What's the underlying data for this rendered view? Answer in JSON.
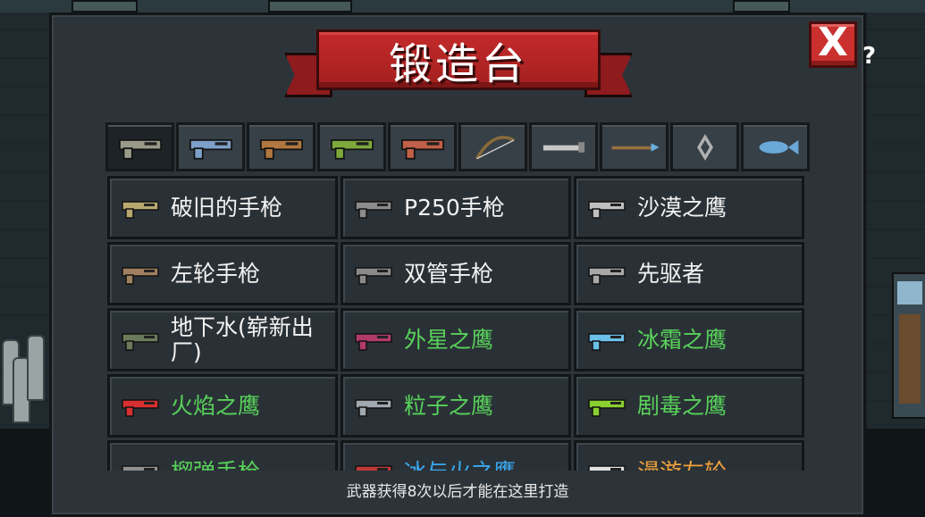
{
  "title": "锻造台",
  "close_icon_label": "X",
  "cut_glyph": "?",
  "colors": {
    "white": "#f2f2f2",
    "green": "#58d25a",
    "blue": "#39a8f0",
    "orange": "#f0a03c",
    "banner": "#b82526"
  },
  "tabs": [
    {
      "icon": "pistol-icon",
      "color": "#9a9a88",
      "active": true
    },
    {
      "icon": "rifle-icon",
      "color": "#7da0c8"
    },
    {
      "icon": "shotgun-icon",
      "color": "#b07840"
    },
    {
      "icon": "launcher-icon",
      "color": "#7ea83c"
    },
    {
      "icon": "flamethrower-icon",
      "color": "#c06048"
    },
    {
      "icon": "bow-icon",
      "color": "#8a6a3a"
    },
    {
      "icon": "blade-icon",
      "color": "#c8c8c8"
    },
    {
      "icon": "spear-icon",
      "color": "#9a7040"
    },
    {
      "icon": "shuriken-icon",
      "color": "#b0b0b0"
    },
    {
      "icon": "fish-icon",
      "color": "#6aa8d8"
    }
  ],
  "weapons": [
    {
      "name": "破旧的手枪",
      "color": "white",
      "icon": "old-pistol-icon",
      "tint": "#b8a870"
    },
    {
      "name": "P250手枪",
      "color": "white",
      "icon": "p250-icon",
      "tint": "#8c8c8c"
    },
    {
      "name": "沙漠之鹰",
      "color": "white",
      "icon": "desert-eagle-icon",
      "tint": "#c0c0c0"
    },
    {
      "name": "左轮手枪",
      "color": "white",
      "icon": "revolver-icon",
      "tint": "#a08060"
    },
    {
      "name": "双管手枪",
      "color": "white",
      "icon": "double-barrel-pistol-icon",
      "tint": "#8a8a8a"
    },
    {
      "name": "先驱者",
      "color": "white",
      "icon": "pioneer-icon",
      "tint": "#a8a8a8"
    },
    {
      "name": "地下水(崭新出厂)",
      "color": "white",
      "icon": "smg-icon",
      "tint": "#6a7a5a"
    },
    {
      "name": "外星之鹰",
      "color": "green",
      "icon": "alien-eagle-icon",
      "tint": "#b03a6a"
    },
    {
      "name": "冰霜之鹰",
      "color": "green",
      "icon": "frost-eagle-icon",
      "tint": "#6ac0e8"
    },
    {
      "name": "火焰之鹰",
      "color": "green",
      "icon": "fire-eagle-icon",
      "tint": "#d83030"
    },
    {
      "name": "粒子之鹰",
      "color": "green",
      "icon": "particle-eagle-icon",
      "tint": "#a0a8b0"
    },
    {
      "name": "剧毒之鹰",
      "color": "green",
      "icon": "poison-eagle-icon",
      "tint": "#8ad030"
    },
    {
      "name": "榴弹手枪",
      "color": "green",
      "icon": "grenade-pistol-icon",
      "tint": "#909090"
    },
    {
      "name": "冰与火之鹰",
      "color": "blue",
      "icon": "ice-fire-eagle-icon",
      "tint": "#c03a3a"
    },
    {
      "name": "漫游左轮",
      "color": "orange",
      "icon": "roaming-revolver-icon",
      "tint": "#e0e0e0"
    }
  ],
  "footer": "武器获得8次以后才能在这里打造"
}
